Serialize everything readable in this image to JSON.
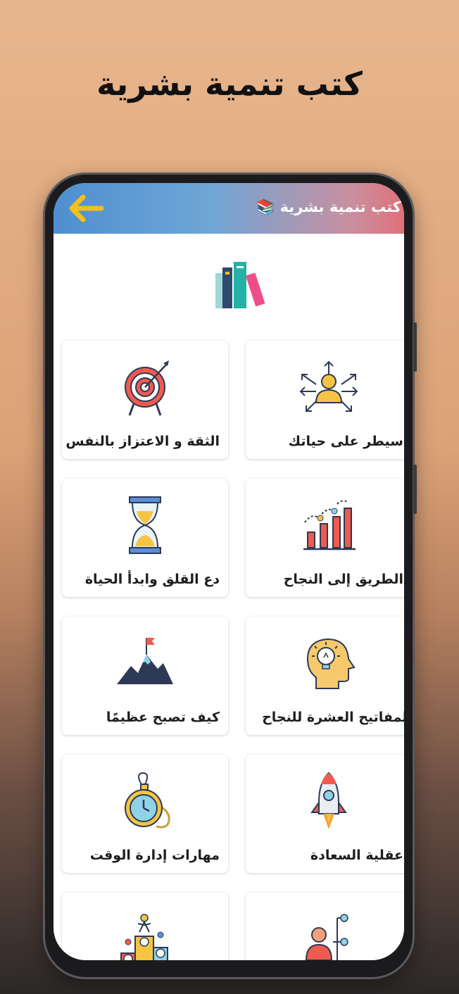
{
  "promo": {
    "title": "كتب تنمية بشرية"
  },
  "appbar": {
    "title": "كتب تنمية بشرية 📚"
  },
  "cards": [
    {
      "label": "سيطر على حياتك",
      "icon": "person-arrows-icon"
    },
    {
      "label": "الثقة و الاعتزاز بالنفس",
      "icon": "target-icon"
    },
    {
      "label": "الطريق إلى النجاح",
      "icon": "bar-chart-icon"
    },
    {
      "label": "دع القلق وابدأ الحياة",
      "icon": "hourglass-icon"
    },
    {
      "label": "المفاتيح العشرة للنجاح",
      "icon": "head-lightbulb-icon"
    },
    {
      "label": "كيف تصبح عظيمًا",
      "icon": "mountain-flag-icon"
    },
    {
      "label": "عقلية السعادة",
      "icon": "rocket-icon"
    },
    {
      "label": "مهارات إدارة الوقت",
      "icon": "pocket-watch-icon"
    },
    {
      "label": "",
      "icon": "org-chart-icon"
    },
    {
      "label": "",
      "icon": "podium-icon"
    }
  ]
}
